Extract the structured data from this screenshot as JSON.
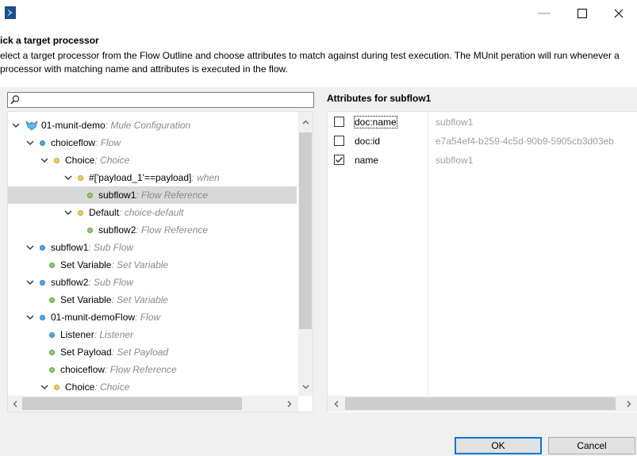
{
  "window": {
    "minimize_glyph": "—",
    "maximize_glyph": "☐",
    "close_glyph": "✕"
  },
  "header": {
    "title": "ick a target processor",
    "description": "elect a target processor from the Flow Outline and choose attributes to match against during test execution. The MUnit peration will run whenever a processor with matching name and attributes is executed in the flow."
  },
  "search": {
    "value": "",
    "placeholder": ""
  },
  "tree": {
    "rows": [
      {
        "name": "01-munit-demo",
        "type": " : Mule Configuration",
        "icon": "mule-icon",
        "twisty": "expanded"
      },
      {
        "name": "choiceflow",
        "type": " : Flow",
        "icon": "blue",
        "twisty": "expanded"
      },
      {
        "name": "Choice",
        "type": " : Choice",
        "icon": "yellow",
        "twisty": "expanded"
      },
      {
        "name": "#['payload_1'==payload]",
        "type": " : when",
        "icon": "yellow",
        "twisty": "expanded"
      },
      {
        "name": "subflow1",
        "type": " : Flow Reference",
        "icon": "green",
        "twisty": "none",
        "selected": true
      },
      {
        "name": "Default",
        "type": " : choice-default",
        "icon": "yellow",
        "twisty": "expanded"
      },
      {
        "name": "subflow2",
        "type": " : Flow Reference",
        "icon": "green",
        "twisty": "none"
      },
      {
        "name": "subflow1",
        "type": " : Sub Flow",
        "icon": "blue",
        "twisty": "expanded"
      },
      {
        "name": "Set Variable",
        "type": " : Set Variable",
        "icon": "green",
        "twisty": "none"
      },
      {
        "name": "subflow2",
        "type": " : Sub Flow",
        "icon": "blue",
        "twisty": "expanded"
      },
      {
        "name": "Set Variable",
        "type": " : Set Variable",
        "icon": "green",
        "twisty": "none"
      },
      {
        "name": "01-munit-demoFlow",
        "type": " : Flow",
        "icon": "blue",
        "twisty": "expanded"
      },
      {
        "name": "Listener",
        "type": " : Listener",
        "icon": "blue",
        "twisty": "none"
      },
      {
        "name": "Set Payload",
        "type": " : Set Payload",
        "icon": "green",
        "twisty": "none"
      },
      {
        "name": "choiceflow",
        "type": " : Flow Reference",
        "icon": "green",
        "twisty": "none"
      },
      {
        "name": "Choice",
        "type": " : Choice",
        "icon": "yellow",
        "twisty": "expanded"
      }
    ]
  },
  "attributes": {
    "title": "Attributes for subflow1",
    "rows": [
      {
        "name": "doc:name",
        "value": "subflow1",
        "checked": false
      },
      {
        "name": "doc:id",
        "value": "e7a54ef4-b259-4c5d-90b9-5905cb3d03eb",
        "checked": false
      },
      {
        "name": "name",
        "value": "subflow1",
        "checked": true
      }
    ]
  },
  "buttons": {
    "ok": "OK",
    "cancel": "Cancel"
  },
  "colors": {
    "selection": "#d9d9d9",
    "flow_dot": "#4fa8e6",
    "router_dot": "#f2cf5b",
    "processor_dot": "#8fcf6a"
  }
}
